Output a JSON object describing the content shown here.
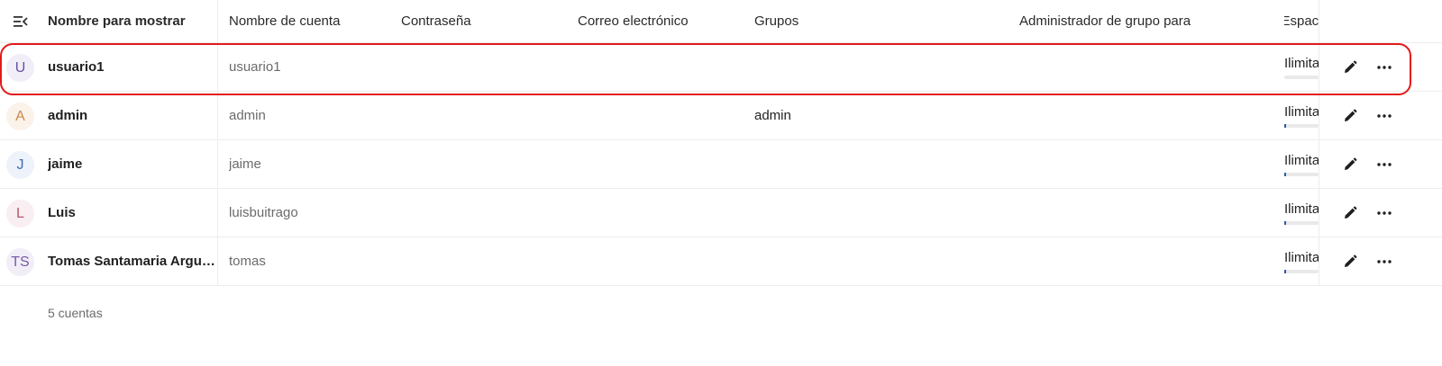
{
  "header": {
    "name": "Nombre para mostrar",
    "account": "Nombre de cuenta",
    "password": "Contraseña",
    "email": "Correo electrónico",
    "groups": "Grupos",
    "subadmin": "Administrador de grupo para",
    "quota": "Espaci"
  },
  "users": [
    {
      "initials": "U",
      "avatar_color": "#6a4fa8",
      "avatar_bg": "#f1eef8",
      "name": "usuario1",
      "account": "usuario1",
      "groups": "",
      "quota": "Ilimita",
      "quota_used_fraction": 0.0
    },
    {
      "initials": "A",
      "avatar_color": "#c98a4a",
      "avatar_bg": "#fbf2ea",
      "name": "admin",
      "account": "admin",
      "groups": "admin",
      "quota": "Ilimita",
      "quota_used_fraction": 0.05
    },
    {
      "initials": "J",
      "avatar_color": "#3f6fb8",
      "avatar_bg": "#eef2fa",
      "name": "jaime",
      "account": "jaime",
      "groups": "",
      "quota": "Ilimita",
      "quota_used_fraction": 0.05
    },
    {
      "initials": "L",
      "avatar_color": "#b35b6e",
      "avatar_bg": "#f9eef1",
      "name": "Luis",
      "account": "luisbuitrago",
      "groups": "",
      "quota": "Ilimita",
      "quota_used_fraction": 0.05
    },
    {
      "initials": "TS",
      "avatar_color": "#7a5ca8",
      "avatar_bg": "#f1eef8",
      "name": "Tomas Santamaria Argu…",
      "account": "tomas",
      "groups": "",
      "quota": "Ilimita",
      "quota_used_fraction": 0.05
    }
  ],
  "footer": {
    "count_text": "5 cuentas"
  },
  "icons": {
    "toggle": "collapse-menu-icon",
    "edit": "pencil-icon",
    "more": "more-horizontal-icon"
  },
  "colors": {
    "highlight": "#e3191a"
  }
}
